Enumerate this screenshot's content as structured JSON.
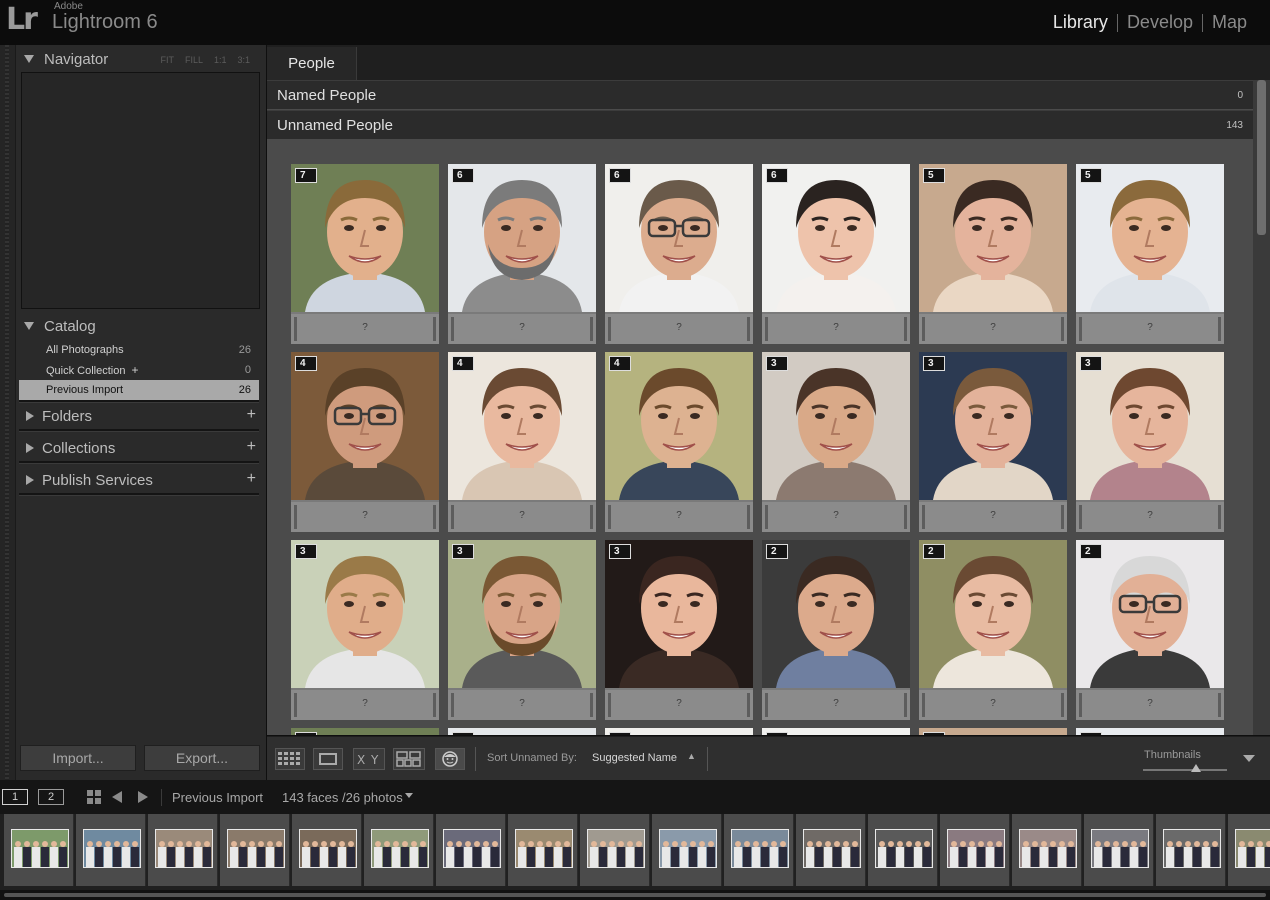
{
  "app": {
    "logo": "Lr",
    "vendor": "Adobe",
    "product": "Lightroom 6"
  },
  "modules": [
    {
      "label": "Library",
      "active": true
    },
    {
      "label": "Develop",
      "active": false
    },
    {
      "label": "Map",
      "active": false
    }
  ],
  "navigator": {
    "title": "Navigator",
    "modes": [
      "FIT",
      "FILL",
      "1:1",
      "3:1"
    ]
  },
  "catalog": {
    "title": "Catalog",
    "items": [
      {
        "label": "All Photographs",
        "count": "26"
      },
      {
        "label": "Quick Collection",
        "plus": "+",
        "count": "0"
      },
      {
        "label": "Previous Import",
        "count": "26",
        "selected": true
      }
    ]
  },
  "panels": [
    {
      "title": "Folders",
      "plus": "+"
    },
    {
      "title": "Collections",
      "plus": "+"
    },
    {
      "title": "Publish Services",
      "plus": "+"
    }
  ],
  "buttons": {
    "import": "Import...",
    "export": "Export..."
  },
  "people": {
    "tab": "People",
    "named": {
      "label": "Named People",
      "count": "0"
    },
    "unnamed": {
      "label": "Unnamed People",
      "count": "143"
    },
    "placeholder": "?",
    "faces": [
      {
        "count": "7",
        "skin": "#e2b08c",
        "hair": "#8a6a3a",
        "bg": "#6f7f55",
        "shirt": "#cfd6e0"
      },
      {
        "count": "6",
        "skin": "#d6a283",
        "hair": "#7b7b7b",
        "bg": "#e4e7ea",
        "shirt": "#8c8c8c",
        "beard": "#6c6c6c"
      },
      {
        "count": "6",
        "skin": "#dcac8e",
        "hair": "#6a5a4a",
        "bg": "#f0efec",
        "shirt": "#f2f2f2",
        "glasses": true
      },
      {
        "count": "6",
        "skin": "#eec3ab",
        "hair": "#2a2320",
        "bg": "#f1f1ef",
        "shirt": "#f4f1ee"
      },
      {
        "count": "5",
        "skin": "#e4b39c",
        "hair": "#3a2a22",
        "bg": "#c7a98e",
        "shirt": "#ead7c4"
      },
      {
        "count": "5",
        "skin": "#e5b392",
        "hair": "#8b6a3c",
        "bg": "#e8ebef",
        "shirt": "#dfe4ea"
      },
      {
        "count": "4",
        "skin": "#cf9b7d",
        "hair": "#5a4128",
        "bg": "#7c5a3a",
        "shirt": "#5a4a3a",
        "glasses": true
      },
      {
        "count": "4",
        "skin": "#e9b99f",
        "hair": "#6a4a33",
        "bg": "#ece6dd",
        "shirt": "#d9c6b3"
      },
      {
        "count": "4",
        "skin": "#ddb291",
        "hair": "#6b4a2c",
        "bg": "#b5b37f",
        "shirt": "#38465a"
      },
      {
        "count": "3",
        "skin": "#d9a988",
        "hair": "#4a3428",
        "bg": "#d2cbc3",
        "shirt": "#8c7a70"
      },
      {
        "count": "3",
        "skin": "#e3b29a",
        "hair": "#7a5a3c",
        "bg": "#2c3a52",
        "shirt": "#e2d6c7"
      },
      {
        "count": "3",
        "skin": "#e6b59c",
        "hair": "#6e4830",
        "bg": "#e6dfd3",
        "shirt": "#b3838c"
      },
      {
        "count": "3",
        "skin": "#e0ad8a",
        "hair": "#9a7a48",
        "bg": "#c9d1b8",
        "shirt": "#e6e6e6"
      },
      {
        "count": "3",
        "skin": "#d8a487",
        "hair": "#7a5834",
        "bg": "#a9b08a",
        "shirt": "#5a5a5a",
        "beard": "#6a4a2a"
      },
      {
        "count": "3",
        "skin": "#e9b79c",
        "hair": "#3a2620",
        "bg": "#221a18",
        "shirt": "#3a2a24"
      },
      {
        "count": "2",
        "skin": "#dcaa8c",
        "hair": "#3a2a22",
        "bg": "#3b3b3b",
        "shirt": "#6f7fa0"
      },
      {
        "count": "2",
        "skin": "#e8bba2",
        "hair": "#6a4a33",
        "bg": "#8f8e63",
        "shirt": "#ede6dc"
      },
      {
        "count": "2",
        "skin": "#e2b096",
        "hair": "#d8d8d8",
        "bg": "#eae8ea",
        "shirt": "#3a3a3a",
        "glasses": true
      }
    ]
  },
  "toolbar": {
    "sort_label": "Sort Unnamed By:",
    "sort_value": "Suggested Name",
    "thumbnails_label": "Thumbnails"
  },
  "filmstrip": {
    "pages": [
      "1",
      "2"
    ],
    "source": "Previous Import",
    "summary": "143 faces /26 photos",
    "photos": [
      "#7d9a6a",
      "#6f8aa0",
      "#9a8a7a",
      "#8a7a6a",
      "#7a6a5a",
      "#8f9a7a",
      "#6a6a7a",
      "#9a8a70",
      "#a09a90",
      "#8a9aaa",
      "#7a8a9a",
      "#6f6a66",
      "#5a5a5a",
      "#8a7a80",
      "#9a8a88",
      "#7a7a80",
      "#6a6a6a",
      "#8a8a70"
    ]
  }
}
